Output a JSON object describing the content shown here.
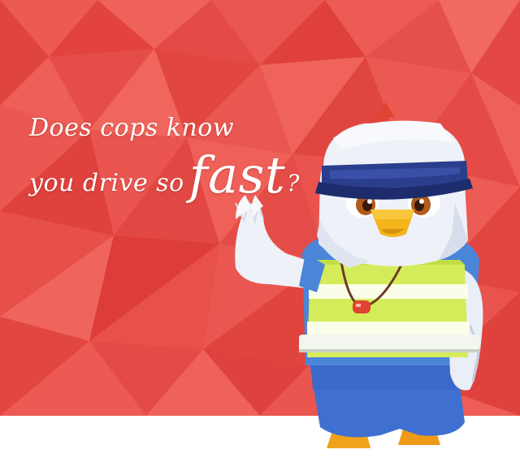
{
  "headline": {
    "line1": "Does cops know",
    "line2_prefix": "you drive so",
    "line2_emphasis": "fast",
    "line2_suffix": "?"
  },
  "colors": {
    "banner_red": "#e54a45",
    "text": "#ffffff",
    "cap_white": "#eef1f7",
    "cap_band": "#2b3e8e",
    "vest_green": "#d5ec5a",
    "vest_white": "#fbfde8",
    "shirt_blue": "#4a85d8",
    "pants_blue": "#3f6fd0",
    "beak_yellow": "#f3b51b",
    "whistle_red": "#e0432f",
    "feet_orange": "#f1a21c"
  },
  "mascot": {
    "character": "eagle-police-officer",
    "icon": "police-eagle-mascot-icon"
  }
}
